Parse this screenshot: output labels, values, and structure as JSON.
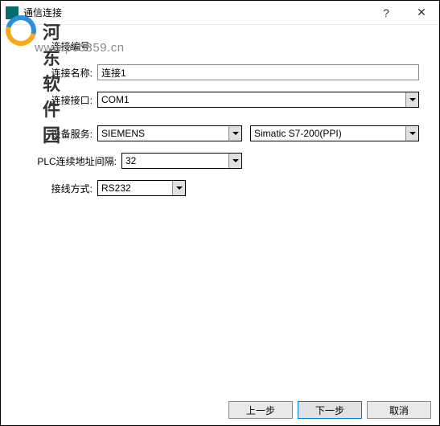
{
  "window": {
    "title": "通信连接",
    "help_icon": "?",
    "close_icon": "✕"
  },
  "watermark": {
    "site_name": "河东软件园",
    "url": "www.pc0359.cn"
  },
  "form": {
    "conn_number_label": "连接编号:",
    "conn_number_value": "",
    "conn_name_label": "连接名称:",
    "conn_name_value": "连接1",
    "conn_port_label": "连接接口:",
    "conn_port_value": "COM1",
    "device_service_label": "设备服务:",
    "device_service_value": "SIEMENS",
    "device_model_value": "Simatic S7-200(PPI)",
    "plc_addr_interval_label": "PLC连续地址间隔:",
    "plc_addr_interval_value": "32",
    "wiring_mode_label": "接线方式:",
    "wiring_mode_value": "RS232"
  },
  "buttons": {
    "prev": "上一步",
    "next": "下一步",
    "cancel": "取消"
  }
}
